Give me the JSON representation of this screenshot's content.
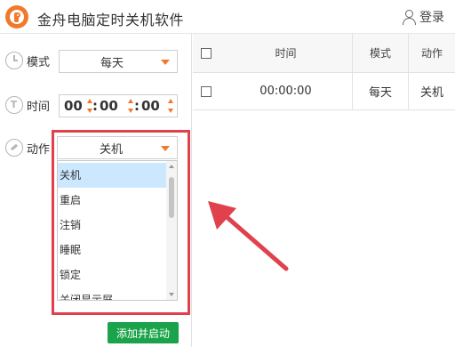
{
  "app": {
    "title": "金舟电脑定时关机软件",
    "login_label": "登录"
  },
  "settings": {
    "mode_label": "模式",
    "mode_value": "每天",
    "time_label": "时间",
    "time_hours": "00",
    "time_minutes": "00",
    "time_seconds": "00",
    "action_label": "动作",
    "action_value": "关机"
  },
  "action_dropdown": {
    "options": [
      "关机",
      "重启",
      "注销",
      "睡眠",
      "锁定",
      "关闭显示屏"
    ],
    "selected_index": 0
  },
  "add_button_label": "添加并启动",
  "task_table": {
    "columns": [
      "时间",
      "模式",
      "动作"
    ],
    "rows": [
      {
        "time": "00:00:00",
        "mode": "每天",
        "action": "关机"
      }
    ]
  },
  "colors": {
    "accent": "#f07a2a",
    "highlight": "#e0414c",
    "button_green": "#1aa34a",
    "selection": "#cce8ff"
  }
}
